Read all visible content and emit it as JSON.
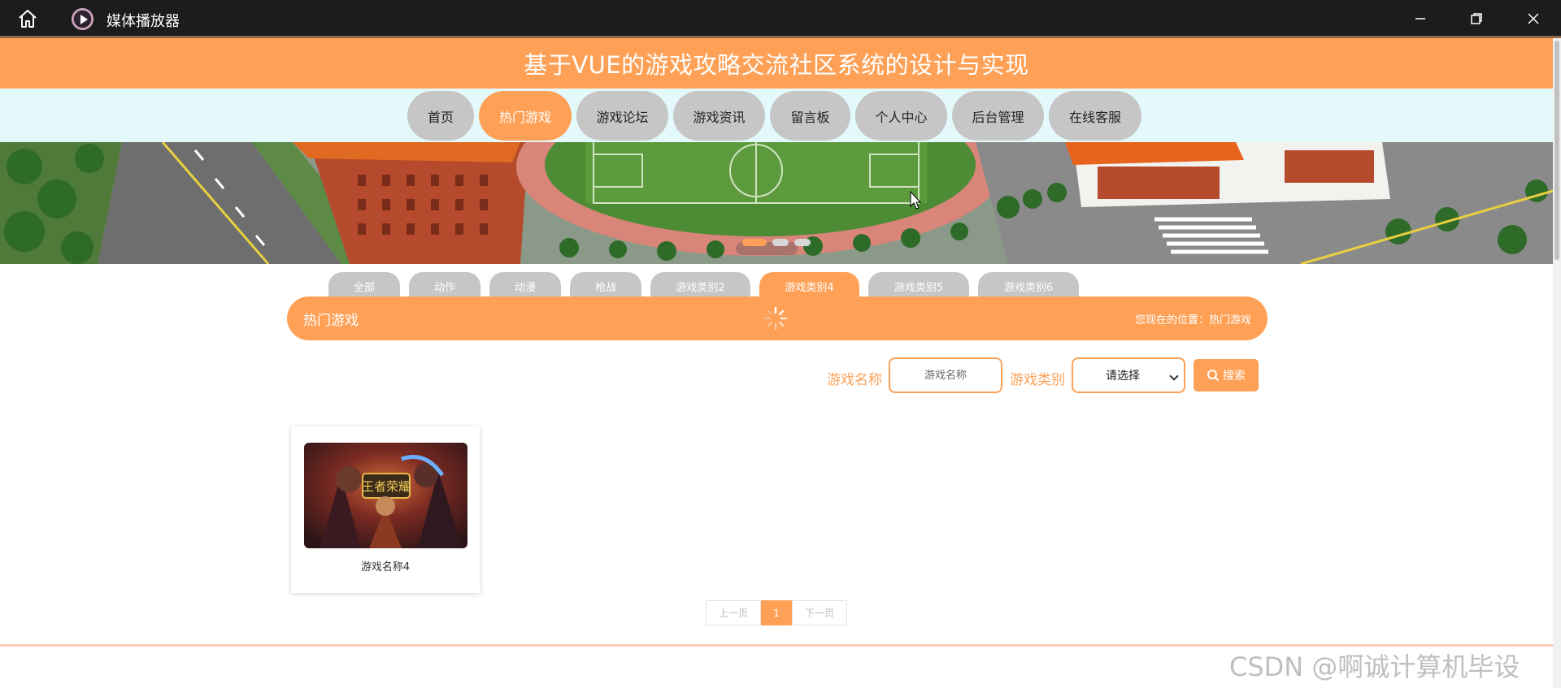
{
  "window": {
    "app_title": "媒体播放器",
    "icons": [
      "home-icon",
      "media-player-icon",
      "minimize-icon",
      "maximize-icon",
      "close-icon"
    ]
  },
  "site": {
    "title": "基于VUE的游戏攻略交流社区系统的设计与实现"
  },
  "nav": {
    "items": [
      "首页",
      "热门游戏",
      "游戏论坛",
      "游戏资讯",
      "留言板",
      "个人中心",
      "后台管理",
      "在线客服"
    ],
    "active": "热门游戏"
  },
  "banner": {
    "dots": 3,
    "active_dot": 1
  },
  "category_tabs": {
    "items": [
      "全部",
      "动作",
      "动漫",
      "枪战",
      "游戏类别2",
      "游戏类别4",
      "游戏类别5",
      "游戏类别6"
    ],
    "active": "游戏类别4"
  },
  "section": {
    "title": "热门游戏",
    "breadcrumb": "您现在的位置：热门游戏"
  },
  "search": {
    "name_label": "游戏名称",
    "name_placeholder": "游戏名称",
    "category_label": "游戏类别",
    "category_selected": "请选择",
    "button_label": "搜索"
  },
  "games": [
    {
      "name": "游戏名称4",
      "thumb_text": "王者荣耀"
    }
  ],
  "pagination": {
    "prev": "上一页",
    "current": "1",
    "next": "下一页"
  },
  "colors": {
    "accent": "#fea157",
    "nav_inactive": "#c6c6c6",
    "nav_band": "#e3f9fb"
  },
  "watermark": "CSDN @啊诚计算机毕设"
}
